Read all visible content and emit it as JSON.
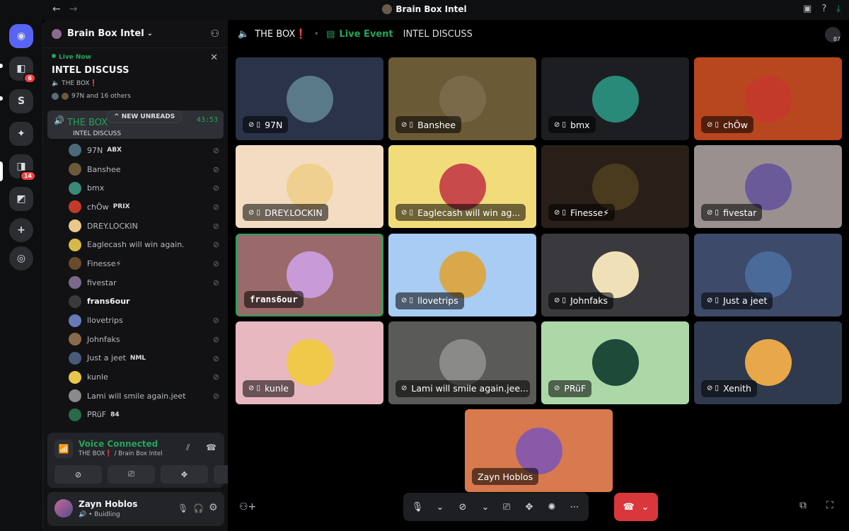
{
  "app": {
    "window_title": "Brain Box Intel",
    "back": "←",
    "forward": "→"
  },
  "guilds": [
    {
      "icon": "discord-home-icon",
      "glyph": "◉",
      "badge": ""
    },
    {
      "icon": "server-folder-icon",
      "glyph": "◧",
      "badge": "6"
    },
    {
      "icon": "server-s-icon",
      "glyph": "S",
      "badge": ""
    },
    {
      "icon": "server-icon",
      "glyph": "✦",
      "badge": ""
    },
    {
      "icon": "server-folder-icon",
      "glyph": "◨",
      "badge": "14"
    },
    {
      "icon": "server-folder-icon",
      "glyph": "◩",
      "badge": ""
    },
    {
      "icon": "add-server-icon",
      "glyph": "+",
      "badge": ""
    },
    {
      "icon": "discover-icon",
      "glyph": "◎",
      "badge": ""
    }
  ],
  "sidebar": {
    "server_name": "Brain Box Intel",
    "live": {
      "status": "Live Now",
      "title": "INTEL DISCUSS",
      "channel": "THE BOX❗",
      "others": "97N and 16 others"
    },
    "voice_channel": {
      "name": "THE BOX",
      "subtitle": "INTEL DISCUSS",
      "timer": "43:53"
    },
    "new_unreads": "NEW UNREADS",
    "members": [
      {
        "name": "97N",
        "tag": "ABX",
        "color": "#4a6a7a",
        "bold": false
      },
      {
        "name": "Banshee",
        "tag": "",
        "color": "#6a5a3a",
        "bold": false
      },
      {
        "name": "bmx",
        "tag": "",
        "color": "#3a8a7a",
        "bold": false
      },
      {
        "name": "chÔw",
        "tag": "PRIX",
        "color": "#c43a2a",
        "bold": false
      },
      {
        "name": "DREY.LOCKIN",
        "tag": "",
        "color": "#e8c88a",
        "bold": false
      },
      {
        "name": "Eaglecash will win again.",
        "tag": "",
        "color": "#d8b84a",
        "bold": false
      },
      {
        "name": "Finesse⚡",
        "tag": "",
        "color": "#6a4a2a",
        "bold": false
      },
      {
        "name": "fivestar",
        "tag": "",
        "color": "#7a6a8a",
        "bold": false
      },
      {
        "name": "frans6our",
        "tag": "",
        "color": "#3a3a3a",
        "bold": true
      },
      {
        "name": "llovetrips",
        "tag": "",
        "color": "#6a7ab8",
        "bold": false
      },
      {
        "name": "Johnfaks",
        "tag": "",
        "color": "#8a6a4a",
        "bold": false
      },
      {
        "name": "Just a jeet",
        "tag": "NML",
        "color": "#4a5a7a",
        "bold": false
      },
      {
        "name": "kunle",
        "tag": "",
        "color": "#e8c84a",
        "bold": false
      },
      {
        "name": "Lami will smile again.jeet",
        "tag": "",
        "color": "#8a8a8a",
        "bold": false
      },
      {
        "name": "PRüF",
        "tag": "84",
        "color": "#2a6a4a",
        "bold": false
      }
    ],
    "voice_panel": {
      "status": "Voice Connected",
      "location": "THE BOX❗ / Brain Box Intel"
    },
    "user": {
      "name": "Zayn Hoblos",
      "status": "Buidling"
    }
  },
  "main": {
    "channel": "THE BOX❗",
    "event_label": "Live Event",
    "topic": "INTEL DISCUSS",
    "viewer_count": "87",
    "tiles": [
      {
        "name": "97N",
        "bg": "#2b3349",
        "av": "#5a7a8a",
        "phone": true
      },
      {
        "name": "Banshee",
        "bg": "#6a5a36",
        "av": "#7a6a4a",
        "phone": true
      },
      {
        "name": "bmx",
        "bg": "#1c1e22",
        "av": "#2a8a7a",
        "phone": true
      },
      {
        "name": "chÔw",
        "bg": "#b8461e",
        "av": "#c43a2a",
        "phone": true
      },
      {
        "name": "DREY.LOCKIN",
        "bg": "#f4dcc2",
        "av": "#f0d090",
        "phone": true
      },
      {
        "name": "Eaglecash will win ag...",
        "bg": "#f2dc7a",
        "av": "#c84a4a",
        "phone": true
      },
      {
        "name": "Finesse⚡",
        "bg": "#2a1e18",
        "av": "#4a3a1e",
        "phone": true
      },
      {
        "name": "fivestar",
        "bg": "#9a9090",
        "av": "#6a5a9a",
        "phone": true
      },
      {
        "name": "frans6our",
        "bg": "#9a6a6a",
        "av": "#c89ad8",
        "phone": false
      },
      {
        "name": "llovetrips",
        "bg": "#a8ccf4",
        "av": "#d8a84a",
        "phone": true
      },
      {
        "name": "Johnfaks",
        "bg": "#3a3a3e",
        "av": "#f0e0b8",
        "phone": true
      },
      {
        "name": "Just a jeet",
        "bg": "#3e4a6a",
        "av": "#4a6a9a",
        "phone": true
      },
      {
        "name": "kunle",
        "bg": "#e8b8c0",
        "av": "#f0c84a",
        "phone": true
      },
      {
        "name": "Lami will smile again.jee...",
        "bg": "#5a5a58",
        "av": "#8a8a88",
        "phone": false
      },
      {
        "name": "PRüF",
        "bg": "#acd8a8",
        "av": "#1e4a3a",
        "phone": false
      },
      {
        "name": "Xenith",
        "bg": "#303a4e",
        "av": "#e8a84a",
        "phone": true
      }
    ],
    "self_tile": {
      "name": "Zayn Hoblos",
      "bg": "#d87a4e",
      "av": "#8a5aa8"
    }
  }
}
